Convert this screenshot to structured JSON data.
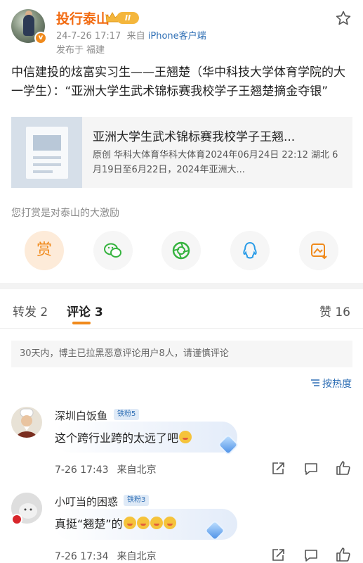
{
  "post": {
    "username": "投行泰山",
    "rank": "II",
    "timestamp": "24-7-26 17:17",
    "source_prefix": "来自",
    "source": "iPhone客户端",
    "location": "发布于 福建",
    "text": "中信建投的炫富实习生——王翘楚（华中科技大学体育学院的大一学生）：“亚洲大学生武术锦标赛我校学子王翘楚摘金夺银”",
    "card": {
      "title": "亚洲大学生武术锦标赛我校学子王翘...",
      "desc": "原创  华科大体育华科大体育2024年06月24日 22:12 湖北 6月19日至6月22日，2024年亚洲大..."
    },
    "reward_label": "您打赏是对泰山的大激励",
    "reward_shang": "赏"
  },
  "tabs": {
    "repost": "转发 2",
    "comments": "评论 3",
    "likes": "赞 16"
  },
  "notice": "30天内，博主已拉黑恶意评论用户8人，请谨慎评论",
  "sort_label": "按热度",
  "comments": [
    {
      "name": "深圳白饭鱼",
      "badge": "铁粉5",
      "text": "这个跨行业跨的太远了吧",
      "time": "7-26 17:43",
      "loc": "来自北京"
    },
    {
      "name": "小叮当的困惑",
      "badge": "铁粉3",
      "text": "真挺“翘楚”的",
      "time": "7-26 17:34",
      "loc": "来自北京"
    }
  ],
  "colors": {
    "accent": "#f08a1c",
    "username": "#f26b12",
    "link": "#2f6fb5"
  }
}
